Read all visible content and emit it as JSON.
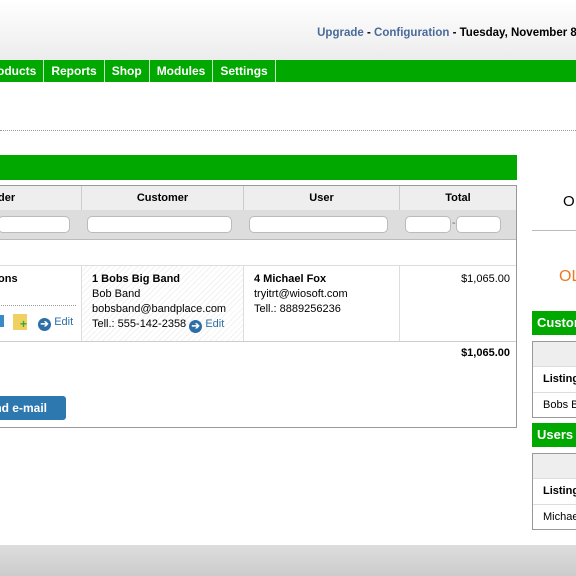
{
  "header": {
    "links": [
      "Upgrade",
      "Configuration"
    ],
    "separator": " - ",
    "date": "Tuesday, November 8,"
  },
  "nav": {
    "items": [
      "oducts",
      "Reports",
      "Shop",
      "Modules",
      "Settings"
    ]
  },
  "table": {
    "headers": [
      "der",
      "Customer",
      "User",
      "Total"
    ],
    "range_separator": "-",
    "row": {
      "actions_label": "ons",
      "customer_name": "1 Bobs Big Band",
      "customer_contact": "Bob Band",
      "customer_email": "bobsband@bandplace.com",
      "customer_phone": "Tell.: 555-142-2358",
      "edit": "Edit",
      "user_name": "4 Michael Fox",
      "user_email": "tryitrt@wiosoft.com",
      "user_phone": "Tell.: 8889256236",
      "total": "$1,065.00"
    },
    "grand_total": "$1,065.00",
    "send_email": "nd e-mail"
  },
  "side": {
    "top_label": "O",
    "orange_label": "OL",
    "customers_title": "Custon",
    "users_title": "Users",
    "listing": "Listing",
    "customer_item": "Bobs B",
    "user_item": "Michae"
  },
  "colors": {
    "green": "#00a800",
    "blue": "#2e78b0",
    "orange": "#f07820"
  }
}
